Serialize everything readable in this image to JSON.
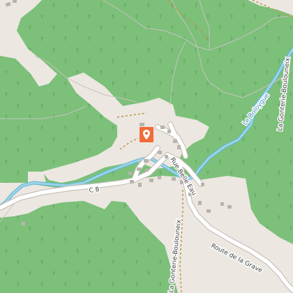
{
  "map": {
    "colors": {
      "forest": "#7cc07a",
      "forest_dark": "#6bb06a",
      "clearing": "#ece7e1",
      "road": "#ffffff",
      "road_casing": "#c9c2bb",
      "water": "#9fd3e6",
      "water_casing": "#5bb5d6",
      "track": "#b99b4e",
      "building": "#b9b3ad",
      "marker": "#f26b3a",
      "label": "#3e3e3e",
      "label_halo": "#ffffff",
      "river_label": "#3f89b3"
    },
    "labels": {
      "road_c8": "C 8",
      "rue_belle_eau": "Rue Belle Eau",
      "route_de_la_grave": "Route de la Grave",
      "la_gonterie_boulouneix_west": "La Gonterie-Boulouneix",
      "la_gonterie_boulouneix_east": "La Gonterie-Boulouneix",
      "river": "Le Boloygue"
    },
    "marker": {
      "icon": "map-pin-icon"
    }
  }
}
